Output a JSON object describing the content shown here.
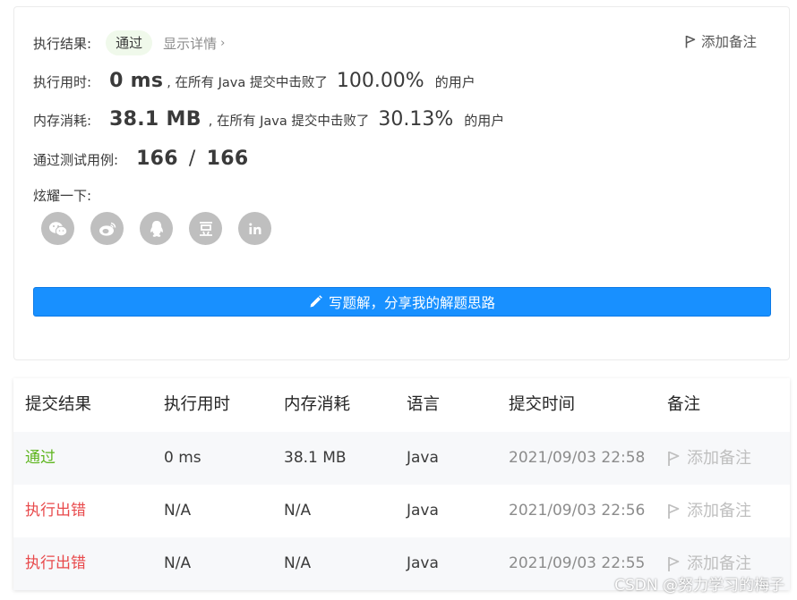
{
  "result": {
    "label": "执行结果:",
    "status": "通过",
    "details_link": "显示详情",
    "chevron": "›",
    "add_note": "添加备注"
  },
  "runtime": {
    "label": "执行用时:",
    "value": "0 ms",
    "mid_text": ", 在所有 Java 提交中击败了",
    "percent": "100.00%",
    "suffix": "的用户"
  },
  "memory": {
    "label": "内存消耗:",
    "value": "38.1 MB",
    "mid_text": ", 在所有 Java 提交中击败了",
    "percent": "30.13%",
    "suffix": "的用户"
  },
  "tests": {
    "label": "通过测试用例:",
    "passed": "166",
    "sep": "/",
    "total": "166"
  },
  "share": {
    "label": "炫耀一下:",
    "icons": [
      "wechat-icon",
      "weibo-icon",
      "qq-icon",
      "douban-icon",
      "linkedin-icon"
    ]
  },
  "write_button": {
    "label": "写题解，分享我的解题思路"
  },
  "table": {
    "headers": [
      "提交结果",
      "执行用时",
      "内存消耗",
      "语言",
      "提交时间",
      "备注"
    ],
    "rows": [
      {
        "status": "通过",
        "runtime": "0 ms",
        "memory": "38.1 MB",
        "language": "Java",
        "time": "2021/09/03 22:58",
        "note": "添加备注"
      },
      {
        "status": "执行出错",
        "runtime": "N/A",
        "memory": "N/A",
        "language": "Java",
        "time": "2021/09/03 22:56",
        "note": "添加备注"
      },
      {
        "status": "执行出错",
        "runtime": "N/A",
        "memory": "N/A",
        "language": "Java",
        "time": "2021/09/03 22:55",
        "note": "添加备注"
      }
    ]
  },
  "watermark": "CSDN @努力学习的梅子",
  "colors": {
    "accent": "#1890ff",
    "pass": "#5eb51e",
    "error": "#e8494b",
    "pass_badge_bg": "#f0f9eb",
    "share_icon_bg": "#bfbfbf"
  }
}
